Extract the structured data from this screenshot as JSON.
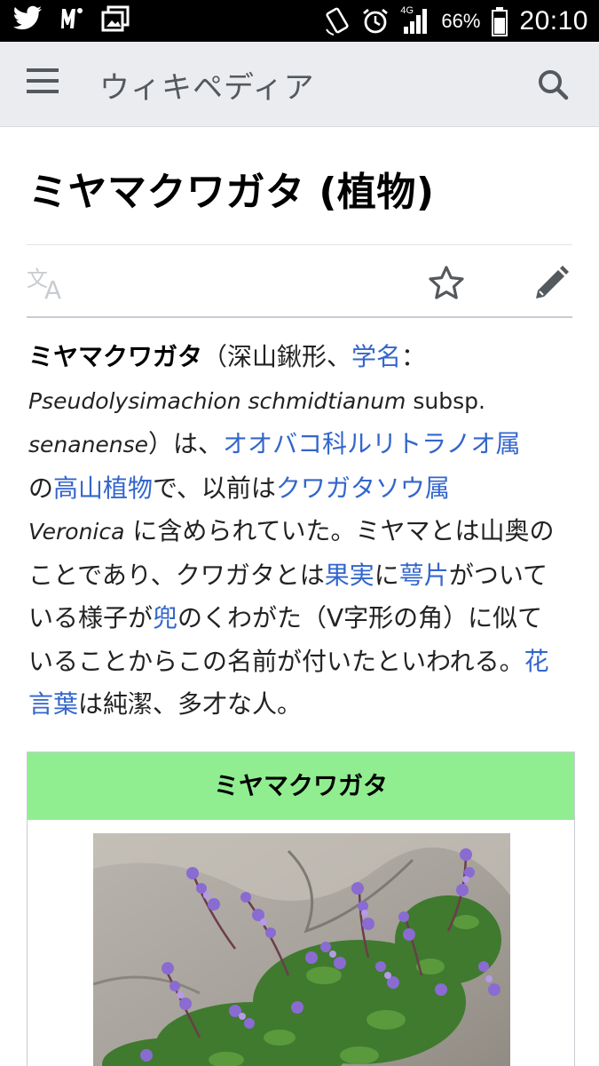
{
  "status_bar": {
    "network": "4G",
    "battery_percent": "66%",
    "time": "20:10",
    "left_icons": [
      "twitter-icon",
      "notification-icon",
      "gallery-icon"
    ],
    "right_icons": [
      "rotate-icon",
      "alarm-icon",
      "signal-icon",
      "battery-icon"
    ]
  },
  "appbar": {
    "title": "ウィキペディア",
    "menu_icon": "menu-icon",
    "search_icon": "search-icon"
  },
  "page": {
    "title": "ミヤマクワガタ (植物)",
    "actions": [
      "language-icon",
      "watch-star-icon",
      "edit-pencil-icon"
    ]
  },
  "article": {
    "lead": "ミヤマクワガタ",
    "t1": "（深山鍬形、",
    "link_gakumei": "学名",
    "t2": "：",
    "sci_name": "Pseudolysimachion schmidtianum",
    "t3": " subsp. ",
    "sci_sub": "senanense",
    "t4": "）は、",
    "link_genus": "オオバコ科ルリトラノオ属",
    "t5": "の",
    "link_alpine": "高山植物",
    "t6": "で、以前は",
    "link_veronica_jp": "クワガタソウ属",
    "t7": " ",
    "sci_veronica": "Veronica",
    "t8": " に含められていた。ミヤマとは山奥のことであり、クワガタとは",
    "link_fruit": "果実",
    "t9": "に",
    "link_bract": "萼片",
    "t10": "がついている様子が",
    "link_helmet": "兜",
    "t11": "のくわがた（V字形の角）に似ていることからこの名前が付いたといわれる。",
    "link_flower_lang": "花言葉",
    "t12": "は純潔、多才な人。"
  },
  "infobox": {
    "title": "ミヤマクワガタ",
    "header_color": "#90ee90",
    "image": "purple-alpine-flowers-photo"
  },
  "colors": {
    "link": "#3366cc",
    "appbar": "#eaecf0"
  }
}
